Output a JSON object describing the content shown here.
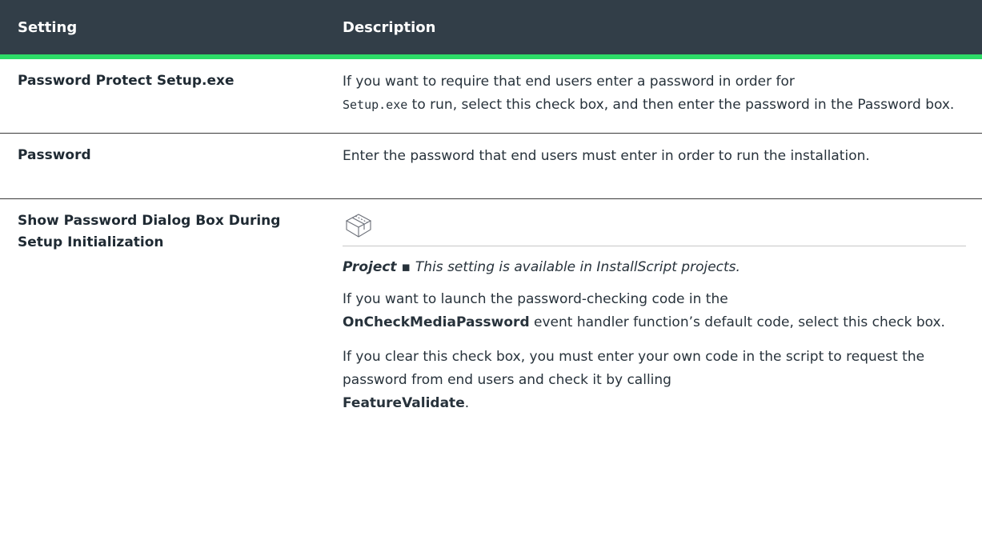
{
  "header": {
    "setting_label": "Setting",
    "description_label": "Description"
  },
  "rows": [
    {
      "setting": "Password Protect Setup.exe",
      "desc_part1": "If you want to require that end users enter a password in order for",
      "desc_code": "Setup.exe",
      "desc_part2": " to run, select this check box, and then enter the password in the Password box."
    },
    {
      "setting": "Password",
      "desc": "Enter the password that end users must enter in order to run the installation."
    },
    {
      "setting": "Show Password Dialog Box During Setup Initialization",
      "icon": "box-package-icon",
      "project_label": "Project",
      "project_sep": " ▪ ",
      "project_text": "This setting is available in InstallScript projects.",
      "para1_pre": "If you want to launch the password-checking code in the",
      "para1_bold": "OnCheckMediaPassword",
      "para1_post": " event handler function’s default code, select this check box.",
      "para2_pre": "If you clear this check box, you must enter your own code in the script to request the password from end users and check it by calling",
      "para2_bold": "FeatureValidate",
      "para2_post": "."
    }
  ],
  "colors": {
    "header_bg": "#323e48",
    "header_accent": "#2ddb67"
  }
}
